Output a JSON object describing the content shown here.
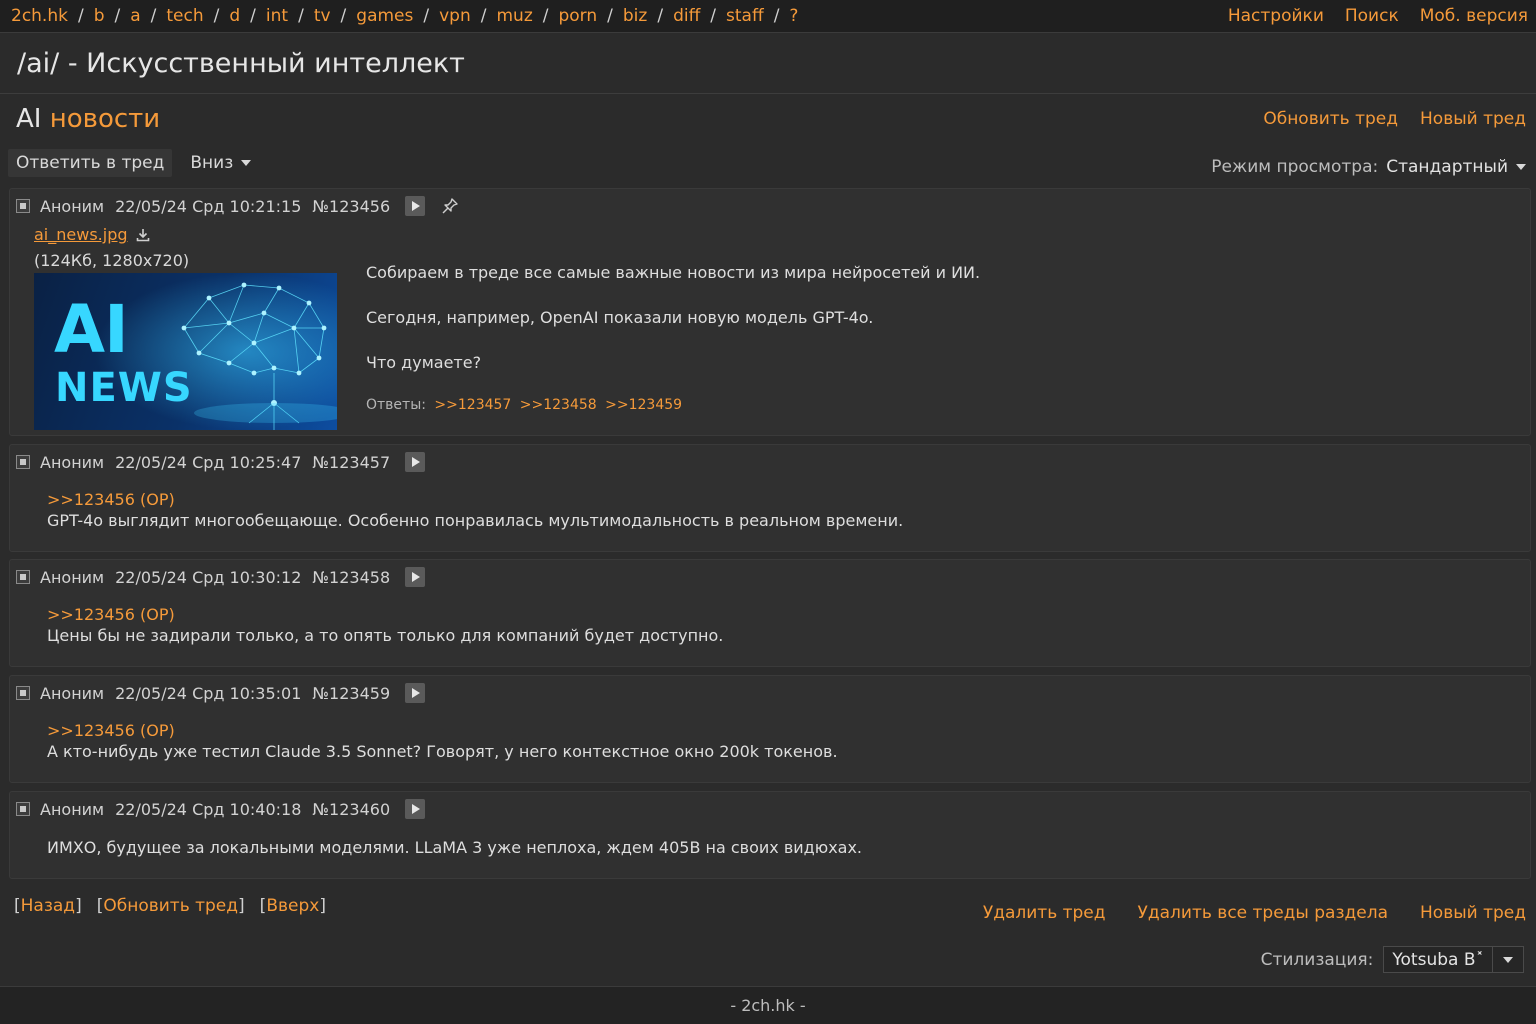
{
  "nav": {
    "boards": [
      "2ch.hk",
      "b",
      "a",
      "tech",
      "d",
      "int",
      "tv",
      "games",
      "vpn",
      "muz",
      "porn",
      "biz",
      "diff",
      "staff",
      "?"
    ],
    "right": [
      "Настройки",
      "Поиск",
      "Моб. версия"
    ]
  },
  "board": {
    "title": "/ai/ - Искусственный интеллект"
  },
  "thread": {
    "title_part1": "AI",
    "title_part2": "новости",
    "update_label": "Обновить тред",
    "new_label": "Новый тред"
  },
  "controls": {
    "reply_label": "Ответить в тред",
    "down_label": "Вниз",
    "view_mode_label": "Режим просмотра:",
    "view_mode_value": "Стандартный"
  },
  "op": {
    "author": "Аноним",
    "date": "22/05/24 Срд 10:21:15",
    "number": "№123456",
    "file_name": "ai_news.jpg",
    "file_meta": "(124Кб, 1280x720)",
    "thumb_text_1": "AI",
    "thumb_text_2": "NEWS",
    "text": [
      "Собираем в треде все самые важные новости из мира нейросетей и ИИ.",
      "Сегодня, например, OpenAI показали новую модель GPT-4o.",
      "Что думаете?"
    ],
    "replies_label": "Ответы:",
    "replies": [
      ">>123457",
      ">>123458",
      ">>123459"
    ]
  },
  "posts": [
    {
      "author": "Аноним",
      "date": "22/05/24 Срд 10:25:47",
      "number": "№123457",
      "ref": ">>123456 (OP)",
      "text": "GPT-4o выглядит многообещающе. Особенно понравилась мультимодальность в реальном времени."
    },
    {
      "author": "Аноним",
      "date": "22/05/24 Срд 10:30:12",
      "number": "№123458",
      "ref": ">>123456 (OP)",
      "text": "Цены бы не задирали только, а то опять только для компаний будет доступно."
    },
    {
      "author": "Аноним",
      "date": "22/05/24 Срд 10:35:01",
      "number": "№123459",
      "ref": ">>123456 (OP)",
      "text": "А кто-нибудь уже тестил Claude 3.5 Sonnet? Говорят, у него контекстное окно 200k токенов."
    },
    {
      "author": "Аноним",
      "date": "22/05/24 Срд 10:40:18",
      "number": "№123460",
      "ref": "",
      "text": "ИМХО, будущее за локальными моделями. LLaMA 3 уже неплоха, ждем 405B на своих видюхах."
    }
  ],
  "bottom": {
    "back": "Назад",
    "update": "Обновить тред",
    "top": "Вверх",
    "delete_thread": "Удалить тред",
    "delete_all": "Удалить все треды раздела",
    "new_thread": "Новый тред",
    "style_label": "Стилизация:",
    "style_value": "Yotsuba B˟"
  },
  "footer": {
    "text": "- 2ch.hk -"
  },
  "colors": {
    "accent": "#f59a3a",
    "background": "#2b2b2b",
    "post_bg": "#303030"
  }
}
